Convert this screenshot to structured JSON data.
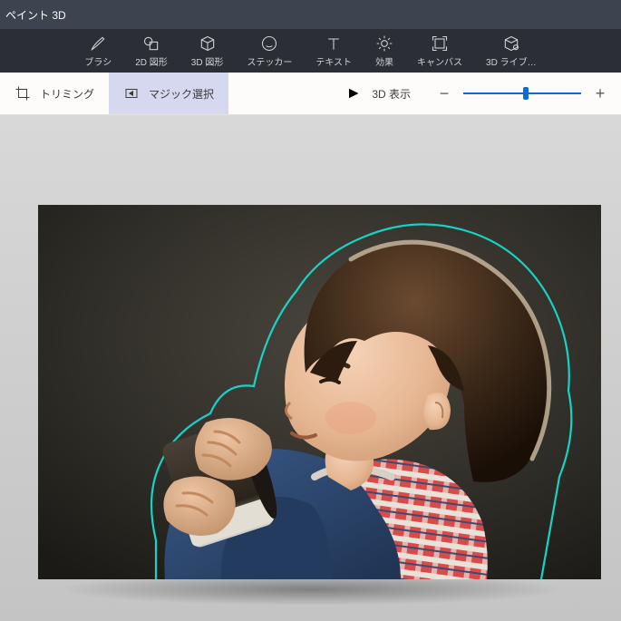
{
  "title": "ペイント 3D",
  "ribbon": {
    "brush": "ブラシ",
    "shape2d": "2D 図形",
    "shape3d": "3D 図形",
    "sticker": "ステッカー",
    "text": "テキスト",
    "effects": "効果",
    "canvas": "キャンバス",
    "library": "3D ライブ…"
  },
  "subbar": {
    "crop": "トリミング",
    "magic": "マジック選択",
    "view3d": "3D 表示"
  },
  "zoom": {
    "minus": "−",
    "plus": "+"
  }
}
